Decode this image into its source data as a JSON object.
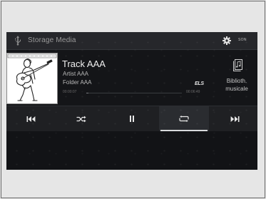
{
  "header": {
    "source_label": "Storage Media",
    "sound_label": "SON"
  },
  "now_playing": {
    "track": "Track AAA",
    "artist": "Artist AAA",
    "folder": "Folder AAA",
    "time_elapsed": "00:00:07",
    "time_total": "00:06:49",
    "progress_fraction": 0.02,
    "audio_badge": "ELS"
  },
  "library": {
    "label_line1": "Biblioth.",
    "label_line2": "musicale"
  },
  "controls": {
    "buttons": [
      {
        "icon": "skip-back-icon"
      },
      {
        "icon": "shuffle-icon"
      },
      {
        "icon": "pause-icon"
      },
      {
        "icon": "repeat-icon",
        "active": true
      },
      {
        "icon": "skip-forward-icon"
      }
    ]
  },
  "colors": {
    "screen_bg": "#141518",
    "bar_bg": "#26272b",
    "text_primary": "#f0f0f0",
    "text_secondary": "#b8b8b8",
    "active_indicator": "#d8dadc"
  }
}
